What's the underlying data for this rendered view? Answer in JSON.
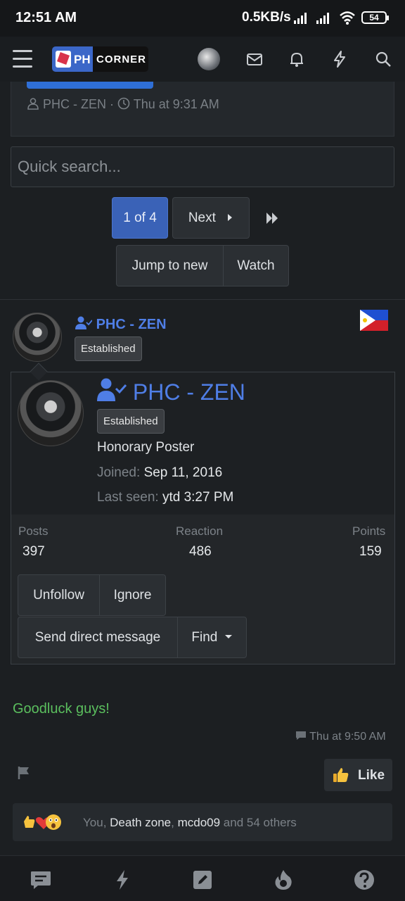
{
  "status_bar": {
    "time": "12:51 AM",
    "speed": "0.5KB/s",
    "battery": "54"
  },
  "header": {
    "logo_ph": "PH",
    "logo_corner": "CORNER"
  },
  "prev_post": {
    "author": "PHC - ZEN",
    "time": "Thu at 9:31 AM"
  },
  "search": {
    "placeholder": "Quick search..."
  },
  "pagination": {
    "current": "1 of 4",
    "next": "Next"
  },
  "thread_actions": {
    "jump": "Jump to new",
    "watch": "Watch"
  },
  "post": {
    "author": "PHC - ZEN",
    "badge": "Established",
    "message": "Goodluck guys!",
    "time": "Thu at 9:50 AM",
    "like_label": "Like",
    "reactions": {
      "you": "You,",
      "user1": "Death zone",
      "comma": ",",
      "user2": "mcdo09",
      "rest": "and 54 others"
    }
  },
  "member_card": {
    "username": "PHC - ZEN",
    "badge": "Established",
    "title": "Honorary Poster",
    "joined_label": "Joined:",
    "joined_value": "Sep 11, 2016",
    "last_seen_label": "Last seen:",
    "last_seen_value": "ytd 3:27 PM",
    "stats": {
      "posts_label": "Posts",
      "posts_value": "397",
      "reaction_label": "Reaction",
      "reaction_value": "486",
      "points_label": "Points",
      "points_value": "159"
    },
    "buttons": {
      "unfollow": "Unfollow",
      "ignore": "Ignore",
      "message": "Send direct message",
      "find": "Find"
    }
  },
  "colors": {
    "link_blue": "#4f7ee6",
    "accent_blue": "#3a62b7",
    "message_green": "#5bbf5e",
    "background": "#1c1f22"
  }
}
